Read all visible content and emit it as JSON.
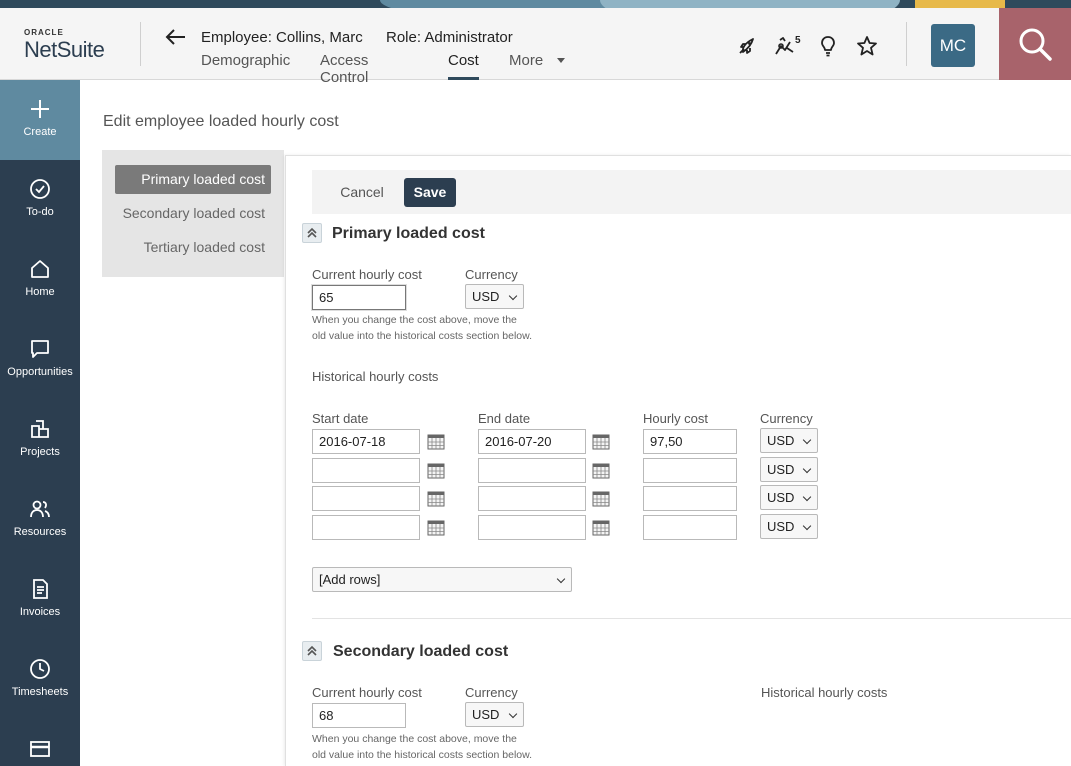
{
  "header": {
    "logo_top": "ORACLE",
    "logo_main": "NetSuite",
    "employee": "Employee: Collins, Marc",
    "role": "Role: Administrator",
    "tabs": [
      {
        "label": "Demographic"
      },
      {
        "label": "Access Control"
      },
      {
        "label": "Cost"
      },
      {
        "label": "More"
      }
    ],
    "notification_count": "5",
    "avatar_initials": "MC"
  },
  "leftnav": {
    "items": [
      {
        "label": "Create",
        "icon": "plus-icon"
      },
      {
        "label": "To-do",
        "icon": "check-circle-icon"
      },
      {
        "label": "Home",
        "icon": "home-icon"
      },
      {
        "label": "Opportunities",
        "icon": "chat-bubble-icon"
      },
      {
        "label": "Projects",
        "icon": "projects-icon"
      },
      {
        "label": "Resources",
        "icon": "people-icon"
      },
      {
        "label": "Invoices",
        "icon": "invoice-icon"
      },
      {
        "label": "Timesheets",
        "icon": "clock-icon"
      },
      {
        "label": "",
        "icon": "card-icon"
      }
    ]
  },
  "page": {
    "title": "Edit employee loaded hourly cost",
    "subnav": [
      "Primary loaded cost",
      "Secondary loaded cost",
      "Tertiary loaded cost"
    ],
    "cancel_label": "Cancel",
    "save_label": "Save"
  },
  "primary": {
    "title": "Primary loaded cost",
    "current_cost_label": "Current hourly cost",
    "current_cost_value": "65",
    "currency_label": "Currency",
    "currency_value": "USD",
    "help_line1": "When you change the cost above, move the",
    "help_line2": "old value into the historical costs section below.",
    "historical_label": "Historical hourly costs",
    "columns": {
      "start": "Start date",
      "end": "End date",
      "cost": "Hourly cost",
      "currency": "Currency"
    },
    "rows": [
      {
        "start": "2016-07-18",
        "end": "2016-07-20",
        "cost": "97,50",
        "currency": "USD"
      },
      {
        "start": "",
        "end": "",
        "cost": "",
        "currency": "USD"
      },
      {
        "start": "",
        "end": "",
        "cost": "",
        "currency": "USD"
      },
      {
        "start": "",
        "end": "",
        "cost": "",
        "currency": "USD"
      }
    ],
    "add_rows": "[Add rows]"
  },
  "secondary": {
    "title": "Secondary loaded cost",
    "current_cost_label": "Current hourly cost",
    "current_cost_value": "68",
    "currency_label": "Currency",
    "currency_value": "USD",
    "help_line1": "When you change the cost above, move the",
    "help_line2": "old value into the historical costs section below.",
    "historical_label": "Historical hourly costs"
  },
  "colors": {
    "nav_bg": "#2c3e50",
    "create_bg": "#5f8aa0",
    "search_bg": "#a8636b",
    "avatar_bg": "#3b6a85",
    "save_bg": "#2c3e50"
  }
}
